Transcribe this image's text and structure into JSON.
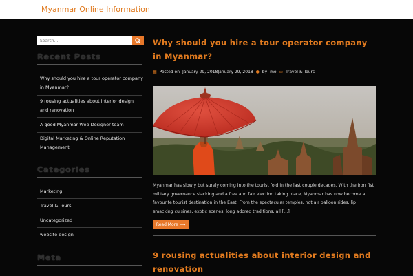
{
  "header": {
    "site_title": "Myanmar Online Information"
  },
  "sidebar": {
    "search": {
      "placeholder": "Search..."
    },
    "recent_posts": {
      "title": "Recent Posts",
      "items": [
        "Why should you hire a tour operator company in Myanmar?",
        "9 rousing actualities about interior design and renovation",
        "A good Myanmar Web Designer team",
        "Digital Marketing & Online Reputation Management"
      ]
    },
    "categories": {
      "title": "Categories",
      "items": [
        "Marketing",
        "Travel & Tours",
        "Uncategorized",
        "website design"
      ]
    },
    "meta": {
      "title": "Meta"
    }
  },
  "posts": [
    {
      "title": "Why should you hire a tour operator company in Myanmar?",
      "meta": {
        "posted_on": "Posted on",
        "date": "January 29, 2018January 29, 2018",
        "by": "by",
        "author": "mo",
        "category": "Travel & Tours"
      },
      "excerpt": "Myanmar has slowly but surely coming into the tourist fold in the last couple decades. With the iron fist military governance slacking and a free and fair election taking place, Myanmar has now become a favourite tourist destination in the East. From the spectacular temples, hot air balloon rides, lip smacking cuisines, exotic scenes, long adored traditions, all […]",
      "read_more": "Read More ⟶"
    },
    {
      "title": "9 rousing actualities about interior design and renovation"
    }
  ],
  "colors": {
    "accent": "#e8782a",
    "background": "#070707"
  },
  "icons": {
    "search": "search-icon",
    "date": "calendar-icon",
    "author": "user-icon",
    "category": "folder-icon"
  }
}
